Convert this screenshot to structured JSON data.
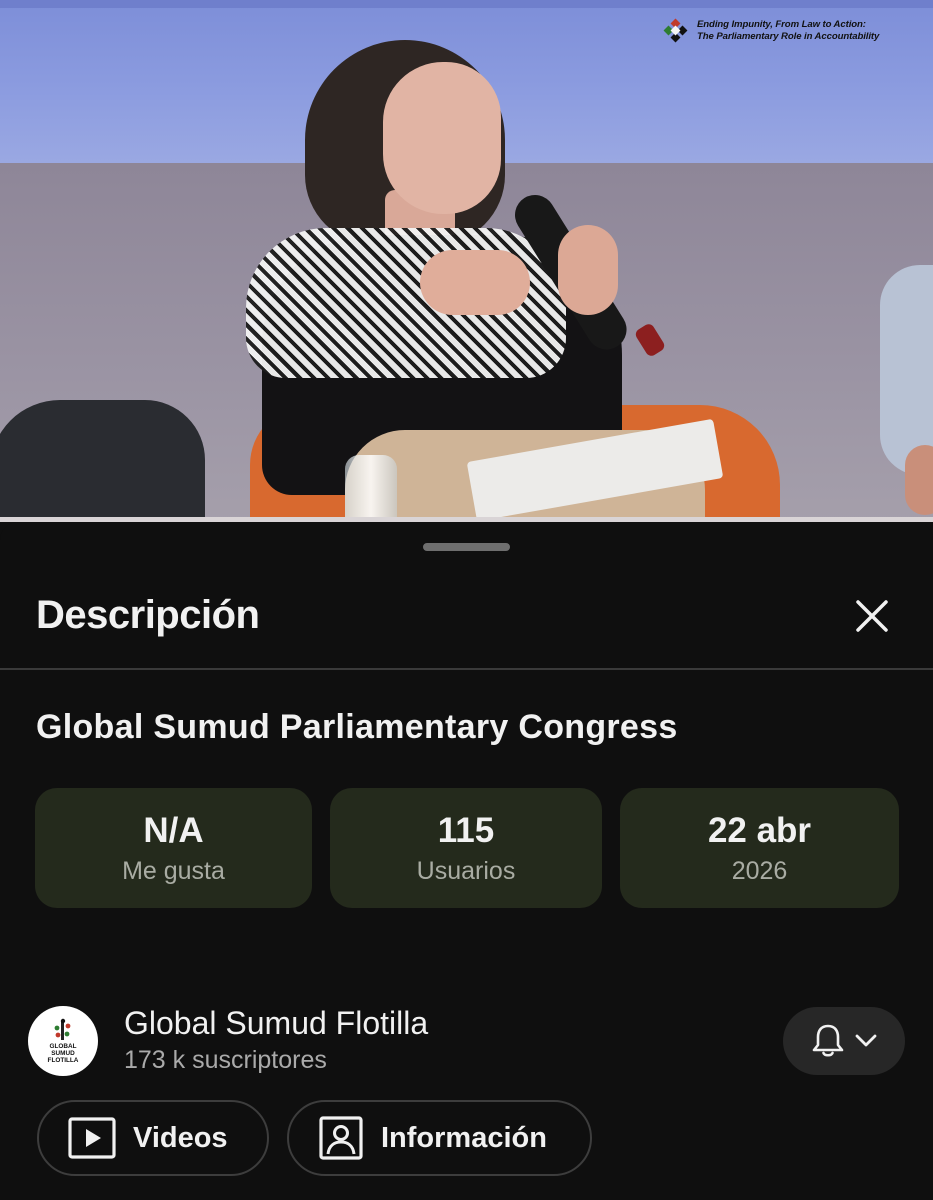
{
  "video": {
    "watermark_line1": "Ending Impunity, From Law to Action:",
    "watermark_line2": "The Parliamentary Role in Accountability"
  },
  "panel": {
    "title": "Descripción",
    "close_icon": "close-icon"
  },
  "video_title": "Global Sumud Parliamentary Congress",
  "stats": [
    {
      "value": "N/A",
      "label": "Me gusta"
    },
    {
      "value": "115",
      "label": "Usuarios"
    },
    {
      "value": "22 abr",
      "label": "2026"
    }
  ],
  "channel": {
    "name": "Global Sumud Flotilla",
    "subscribers": "173 k suscriptores",
    "avatar_text": [
      "GLOBAL",
      "SUMUD",
      "FLOTILLA"
    ],
    "bell_icon": "bell-icon",
    "chevron_icon": "chevron-down-icon"
  },
  "buttons": {
    "videos": "Videos",
    "info": "Información"
  },
  "colors": {
    "background": "#0f0f0f",
    "stat_card": "#242a1c",
    "text_primary": "#f1f1f1",
    "text_secondary": "#aaaaaa"
  }
}
